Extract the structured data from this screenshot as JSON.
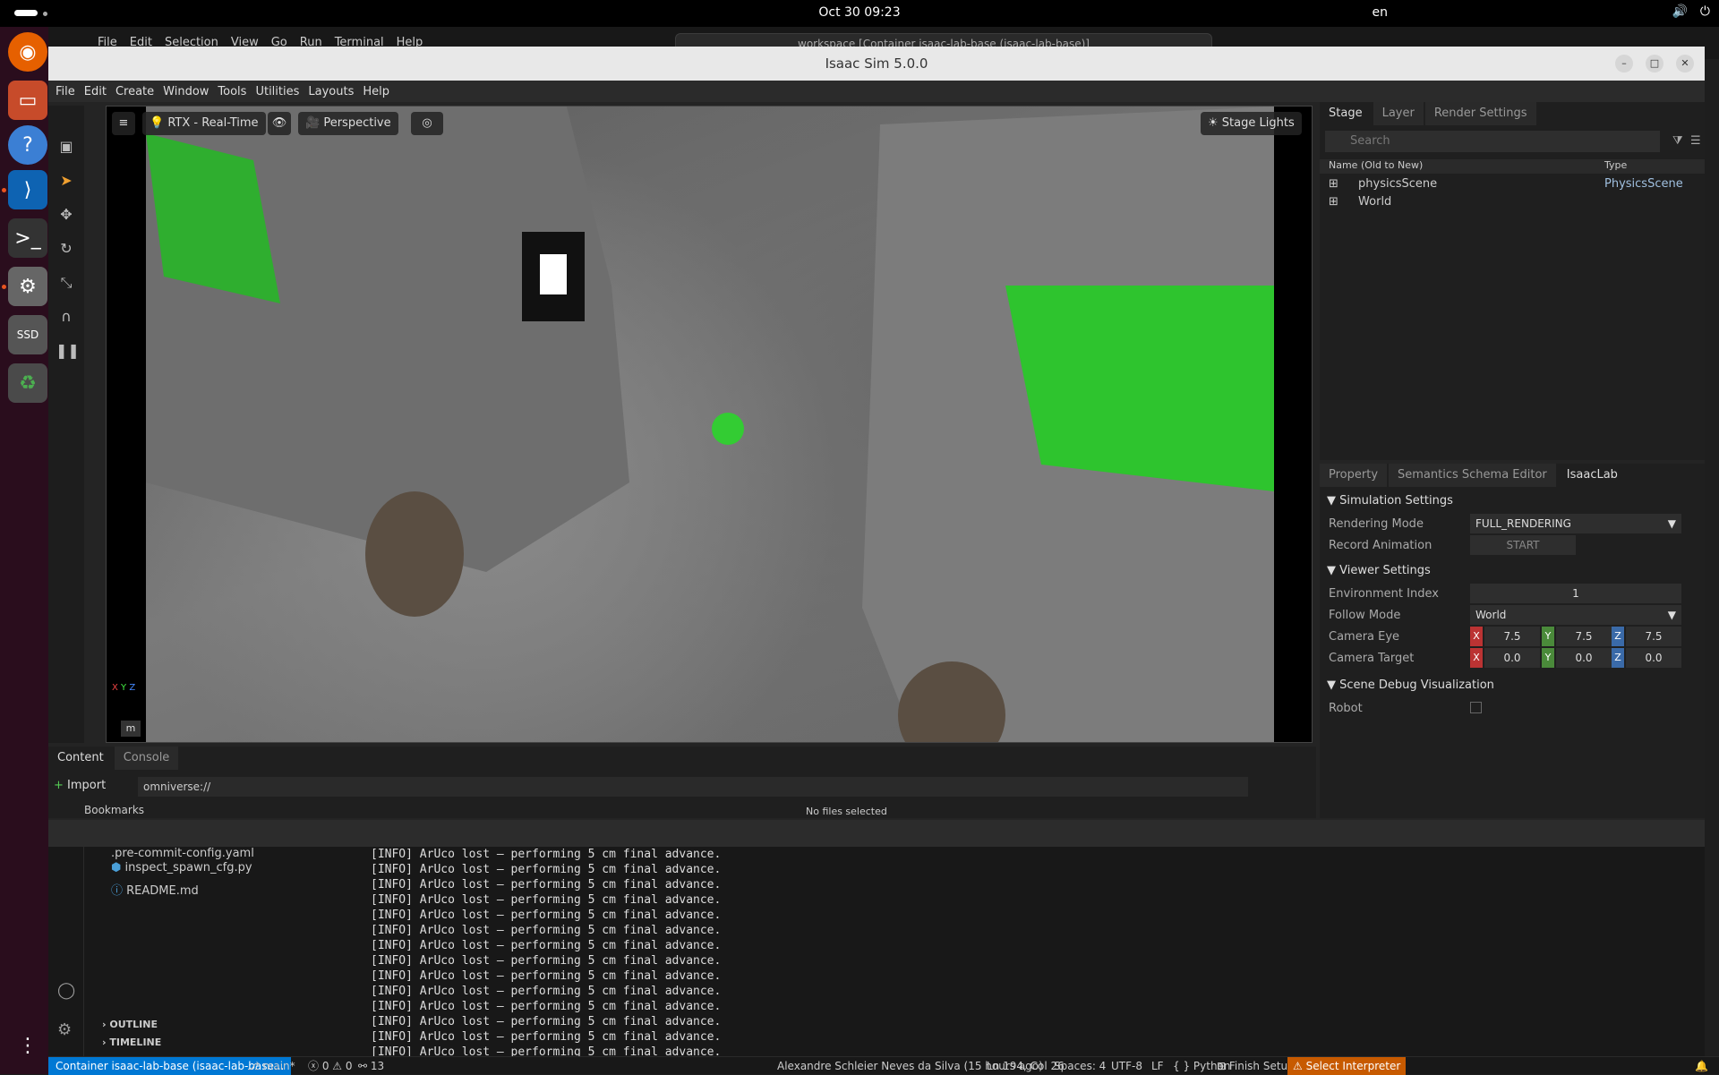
{
  "system": {
    "clock": "Oct 30  09:23",
    "language": "en"
  },
  "vscode": {
    "menu": [
      "File",
      "Edit",
      "Selection",
      "View",
      "Go",
      "Run",
      "Terminal",
      "Help"
    ],
    "command_center": "workspace [Container isaac-lab-base (isaac-lab-base)]",
    "explorer_items": [
      ".pre-commit-config.yaml",
      "inspect_spawn_cfg.py",
      "README.md"
    ],
    "sections": [
      "OUTLINE",
      "TIMELINE"
    ],
    "terminal_lines": [
      "[INFO] ArUco lost – performing 5 cm final advance.",
      "[INFO] ArUco lost – performing 5 cm final advance.",
      "[INFO] ArUco lost – performing 5 cm final advance.",
      "[INFO] ArUco lost – performing 5 cm final advance.",
      "[INFO] ArUco lost – performing 5 cm final advance.",
      "[INFO] ArUco lost – performing 5 cm final advance.",
      "[INFO] ArUco lost – performing 5 cm final advance.",
      "[INFO] ArUco lost – performing 5 cm final advance.",
      "[INFO] ArUco lost – performing 5 cm final advance.",
      "[INFO] ArUco lost – performing 5 cm final advance.",
      "[INFO] ArUco lost – performing 5 cm final advance.",
      "[INFO] ArUco lost – performing 5 cm final advance.",
      "[INFO] ArUco lost – performing 5 cm final advance.",
      "[INFO] ArUco lost – performing 5 cm final advance."
    ],
    "status": {
      "remote": "Container isaac-lab-base (isaac-lab-base...",
      "branch": "main*",
      "problems": "0 ⚠ 0",
      "ports": "13",
      "blame": "Alexandre Schleier Neves da Silva (15 hours ago)",
      "position": "Ln 194, Col 26",
      "spaces": "Spaces: 4",
      "encoding": "UTF-8",
      "eol": "LF",
      "language": "{ } Python",
      "finish": "Finish Setup",
      "interpreter": "Select Interpreter"
    }
  },
  "isaac": {
    "title": "Isaac Sim 5.0.0",
    "menu": [
      "File",
      "Edit",
      "Create",
      "Window",
      "Tools",
      "Utilities",
      "Layouts",
      "Help"
    ],
    "viewport": {
      "render_mode": "RTX - Real-Time",
      "camera": "Perspective",
      "lights": "Stage Lights",
      "unit": "m",
      "axes": [
        "X",
        "Y",
        "Z"
      ]
    },
    "stage": {
      "tabs": [
        "Stage",
        "Layer",
        "Render Settings"
      ],
      "search_placeholder": "Search",
      "col_name": "Name (Old to New)",
      "col_type": "Type",
      "rows": [
        {
          "name": "physicsScene",
          "type": "PhysicsScene"
        },
        {
          "name": "World",
          "type": ""
        }
      ]
    },
    "props": {
      "tabs": [
        "Property",
        "Semantics Schema Editor",
        "IsaacLab"
      ],
      "sim_settings": "Simulation Settings",
      "rendering_mode_label": "Rendering Mode",
      "rendering_mode_value": "FULL_RENDERING",
      "record_label": "Record Animation",
      "record_btn": "START",
      "viewer_settings": "Viewer Settings",
      "env_index_label": "Environment Index",
      "env_index_value": "1",
      "follow_label": "Follow Mode",
      "follow_value": "World",
      "cam_eye_label": "Camera Eye",
      "cam_eye": [
        "7.5",
        "7.5",
        "7.5"
      ],
      "cam_target_label": "Camera Target",
      "cam_target": [
        "0.0",
        "0.0",
        "0.0"
      ],
      "debug_vis": "Scene Debug Visualization",
      "robot_label": "Robot"
    },
    "content": {
      "tabs": [
        "Content",
        "Console"
      ],
      "import": "Import",
      "path": "omniverse://",
      "bookmarks": "Bookmarks",
      "no_files": "No files selected"
    }
  }
}
